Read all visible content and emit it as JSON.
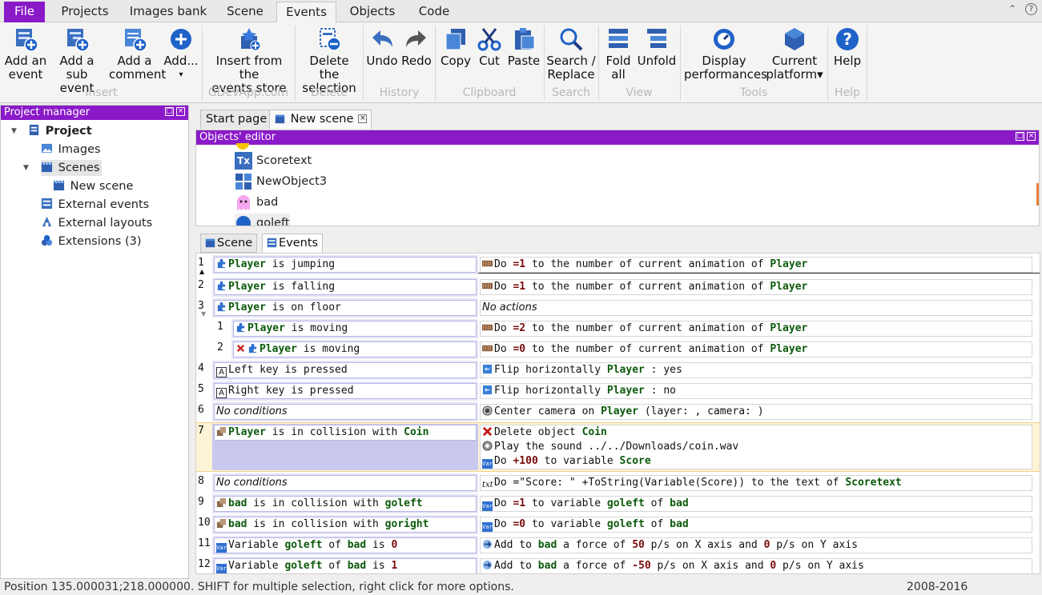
{
  "menu_tabs": [
    "File",
    "Projects",
    "Images bank",
    "Scene",
    "Events",
    "Objects",
    "Code"
  ],
  "ribbon": {
    "buttons": [
      {
        "l1": "Add an",
        "l2": "event"
      },
      {
        "l1": "Add a sub",
        "l2": "event"
      },
      {
        "l1": "Add a",
        "l2": "comment"
      },
      {
        "l1": "Add...",
        "l2": "▾"
      },
      {
        "l1": "Insert from the",
        "l2": "events store"
      },
      {
        "l1": "Delete the",
        "l2": "selection"
      },
      {
        "l1": "Undo",
        "l2": ""
      },
      {
        "l1": "Redo",
        "l2": ""
      },
      {
        "l1": "Copy",
        "l2": ""
      },
      {
        "l1": "Cut",
        "l2": ""
      },
      {
        "l1": "Paste",
        "l2": ""
      },
      {
        "l1": "Search /",
        "l2": "Replace"
      },
      {
        "l1": "Fold",
        "l2": "all"
      },
      {
        "l1": "Unfold",
        "l2": ""
      },
      {
        "l1": "Display",
        "l2": "performances"
      },
      {
        "l1": "Current",
        "l2": "platform▾"
      },
      {
        "l1": "Help",
        "l2": ""
      }
    ],
    "groups": [
      "Insert",
      "GDevApp.com",
      "Delete",
      "History",
      "Clipboard",
      "Search",
      "View",
      "Tools",
      "Help"
    ]
  },
  "project_manager": {
    "title": "Project manager",
    "items": [
      "Project",
      "Images",
      "Scenes",
      "New scene",
      "External events",
      "External layouts",
      "Extensions (3)"
    ]
  },
  "doc_tabs": [
    "Start page",
    "New scene"
  ],
  "objects_editor": {
    "title": "Objects' editor",
    "objects": [
      "Scoretext",
      "NewObject3",
      "bad",
      "goleft"
    ]
  },
  "event_tabs": [
    "Scene",
    "Events"
  ],
  "events": {
    "numbers": [
      "1",
      "2",
      "3",
      "1",
      "2",
      "4",
      "5",
      "6",
      "7",
      "8",
      "9",
      "10",
      "11",
      "12"
    ],
    "no_actions": "No actions",
    "no_conditions": "No conditions",
    "w": {
      "player": "Player",
      "coin": "Coin",
      "score": "Score",
      "scoretext": "Scoretext",
      "bad": "bad",
      "goleft": "goleft",
      "goright": "goright",
      "is_jumping": " is jumping",
      "is_falling": " is falling",
      "is_on_floor": " is on floor",
      "is_moving": " is moving",
      "left_key": "Left key is pressed",
      "right_key": "Right key is pressed",
      "in_collision": " is in collision with ",
      "variable": "Variable ",
      "of": " of ",
      "is": " is ",
      "do": "Do ",
      "eq1": "=1",
      "eq2": "=2",
      "eq0": "=0",
      "plus100": "+100",
      "anim_mid": " to the number of current animation of ",
      "flip": "Flip horizontally ",
      "yes": " : yes",
      "no": " : no",
      "center": "Center camera on ",
      "center_tail": " (layer: , camera: )",
      "delete_obj": "Delete object ",
      "play_sound": "Play the sound ../../Downloads/coin.wav",
      "to_variable": " to variable ",
      "score_text": "=\"Score: \" +ToString(Variable(Score))",
      "to_text": " to the text of ",
      "add_to": "Add to ",
      "force": " a force of ",
      "ps_x": " p/s on X axis and ",
      "ps_y": " p/s on Y axis",
      "v0": "0",
      "v1": "1",
      "v50": "50",
      "vm50": "-50"
    }
  },
  "status": {
    "left": "Position 135.000031;218.000000. SHIFT for multiple selection, right click for more options.",
    "right": "2008-2016"
  },
  "colors": {
    "accent": "#8a1ac8",
    "selected_event": "#fdf3d6",
    "condition_bg": "#e6e6f6",
    "object_name": "#0c5a0c",
    "value": "#7a0c0c"
  }
}
